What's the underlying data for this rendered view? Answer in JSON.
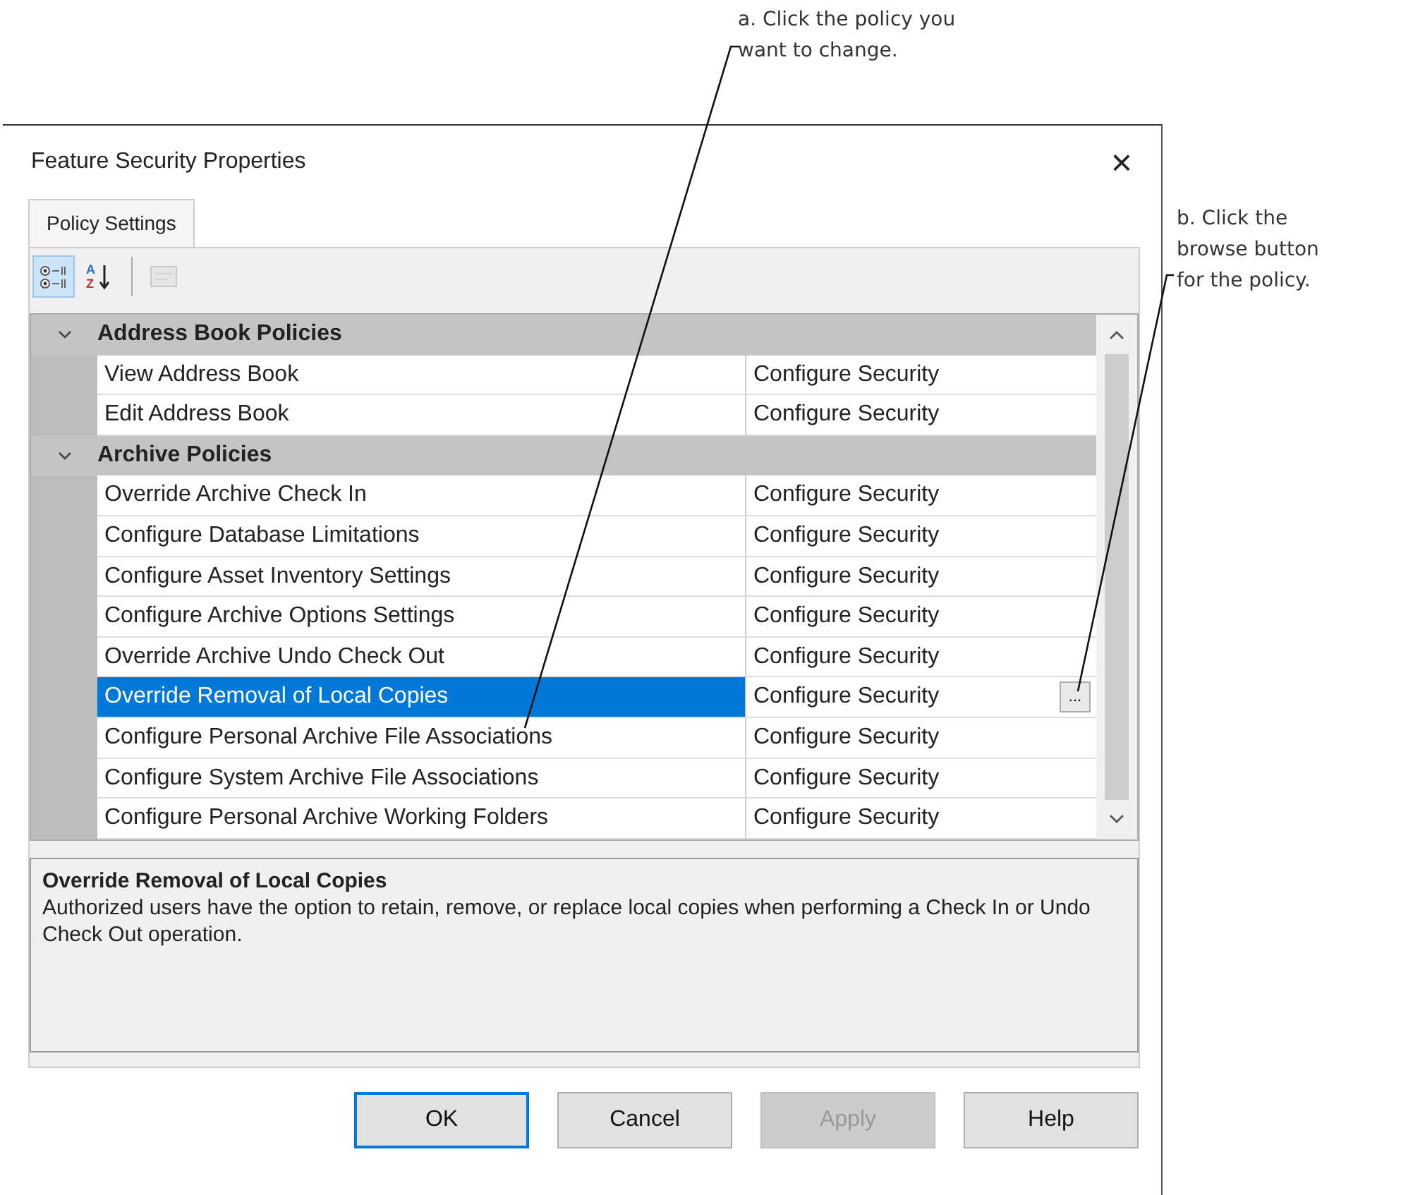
{
  "callouts": [
    {
      "lines": [
        "a. Click the policy you",
        "want to change."
      ]
    },
    {
      "lines": [
        "b. Click the",
        "browse button",
        "for the policy."
      ]
    }
  ],
  "window": {
    "title": "Feature Security Properties",
    "close": "×"
  },
  "tabs": [
    {
      "label": "Policy Settings",
      "selected": true
    }
  ],
  "toolbar": [
    {
      "kind": "categorized",
      "selected": true,
      "disabled": false
    },
    {
      "kind": "alphabetical",
      "selected": false,
      "disabled": false,
      "letters": [
        "A",
        "Z"
      ]
    },
    {
      "kind": "separator"
    },
    {
      "kind": "pages",
      "selected": false,
      "disabled": true
    }
  ],
  "groups": [
    {
      "label": "Address Book Policies",
      "expanded": true,
      "items": [
        {
          "name": "View Address Book",
          "value": "Configure Security",
          "selected": false
        },
        {
          "name": "Edit Address Book",
          "value": "Configure Security",
          "selected": false
        }
      ]
    },
    {
      "label": "Archive Policies",
      "expanded": true,
      "items": [
        {
          "name": "Override Archive Check In",
          "value": "Configure Security",
          "selected": false
        },
        {
          "name": "Configure Database Limitations",
          "value": "Configure Security",
          "selected": false
        },
        {
          "name": "Configure Asset Inventory Settings",
          "value": "Configure Security",
          "selected": false
        },
        {
          "name": "Configure Archive Options Settings",
          "value": "Configure Security",
          "selected": false
        },
        {
          "name": "Override Archive Undo Check Out",
          "value": "Configure Security",
          "selected": false
        },
        {
          "name": "Override Removal of Local Copies",
          "value": "Configure Security",
          "selected": true,
          "browse": "..."
        },
        {
          "name": "Configure Personal Archive File Associations",
          "value": "Configure Security",
          "selected": false
        },
        {
          "name": "Configure System Archive File Associations",
          "value": "Configure Security",
          "selected": false
        },
        {
          "name": "Configure Personal Archive Working Folders",
          "value": "Configure Security",
          "selected": false
        }
      ]
    }
  ],
  "description": {
    "title": "Override Removal of Local Copies",
    "text": "Authorized users have the option to retain, remove, or replace local copies when performing a Check In or Undo Check Out operation."
  },
  "buttons": [
    {
      "label": "OK",
      "default": true,
      "disabled": false
    },
    {
      "label": "Cancel",
      "default": false,
      "disabled": false
    },
    {
      "label": "Apply",
      "default": false,
      "disabled": true
    },
    {
      "label": "Help",
      "default": false,
      "disabled": false
    }
  ]
}
